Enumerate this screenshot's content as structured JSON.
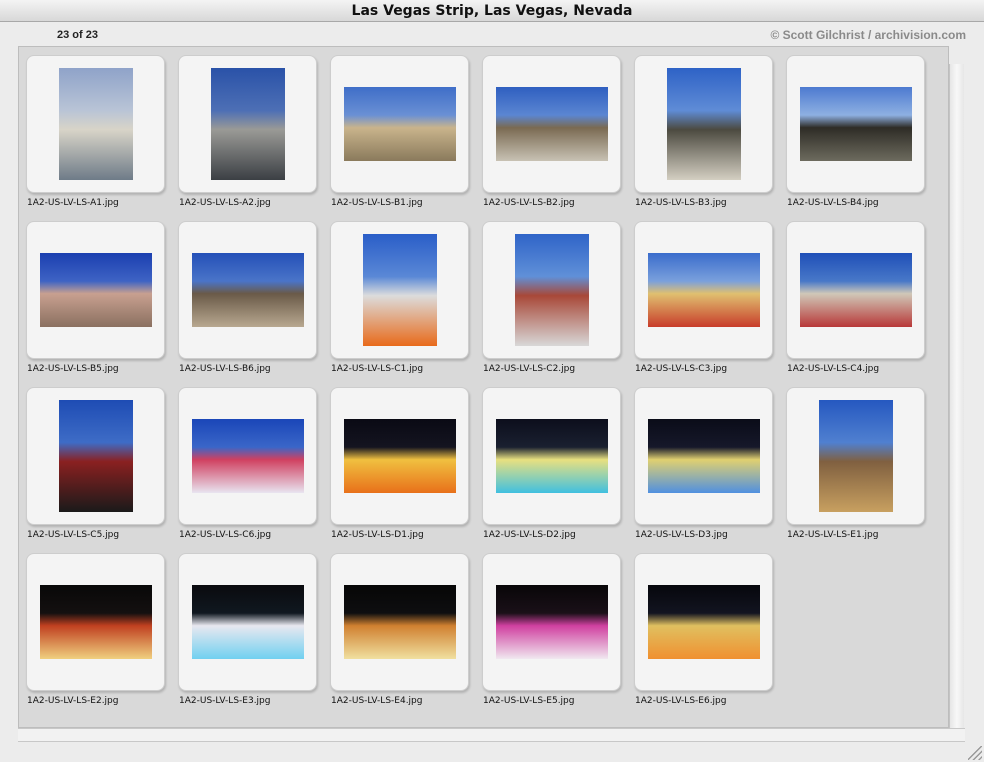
{
  "window": {
    "title": "Las Vegas Strip, Las Vegas, Nevada"
  },
  "header": {
    "count": "23 of 23",
    "copyright": "© Scott Gilchrist / archivision.com"
  },
  "thumbnails": [
    {
      "filename": "1A2-US-LV-LS-A1.jpg",
      "orientation": "portrait",
      "palette": [
        "#8fa3c9",
        "#b9c4d6",
        "#6e7b88",
        "#d8d4c8"
      ]
    },
    {
      "filename": "1A2-US-LV-LS-A2.jpg",
      "orientation": "portrait",
      "palette": [
        "#2a52a8",
        "#4d6fb5",
        "#3b3f44",
        "#9a9a96"
      ]
    },
    {
      "filename": "1A2-US-LV-LS-B1.jpg",
      "orientation": "landscape",
      "palette": [
        "#3f6ec8",
        "#6a90d4",
        "#8a7a5c",
        "#c9b48c"
      ]
    },
    {
      "filename": "1A2-US-LV-LS-B2.jpg",
      "orientation": "landscape",
      "palette": [
        "#2f5fc0",
        "#5b86d2",
        "#c8c2b4",
        "#7a6a52"
      ]
    },
    {
      "filename": "1A2-US-LV-LS-B3.jpg",
      "orientation": "portrait",
      "palette": [
        "#2e62c6",
        "#5f8cd6",
        "#d4cfc2",
        "#4c4a40"
      ]
    },
    {
      "filename": "1A2-US-LV-LS-B4.jpg",
      "orientation": "landscape",
      "palette": [
        "#4d7ad0",
        "#8eb0e2",
        "#6d6b5e",
        "#2e2c26"
      ]
    },
    {
      "filename": "1A2-US-LV-LS-B5.jpg",
      "orientation": "landscape",
      "palette": [
        "#1b3fb0",
        "#3e63c4",
        "#8a7060",
        "#c8a090"
      ]
    },
    {
      "filename": "1A2-US-LV-LS-B6.jpg",
      "orientation": "landscape",
      "palette": [
        "#2450b8",
        "#4a74c8",
        "#b8a890",
        "#6a5a48"
      ]
    },
    {
      "filename": "1A2-US-LV-LS-C1.jpg",
      "orientation": "portrait",
      "palette": [
        "#2a5ec8",
        "#5a88d6",
        "#e86a1a",
        "#dcdcdc"
      ]
    },
    {
      "filename": "1A2-US-LV-LS-C2.jpg",
      "orientation": "portrait",
      "palette": [
        "#2f64c8",
        "#6090d8",
        "#d8d8d8",
        "#a84838"
      ]
    },
    {
      "filename": "1A2-US-LV-LS-C3.jpg",
      "orientation": "landscape",
      "palette": [
        "#3a6ccc",
        "#7aa0dc",
        "#c83c2a",
        "#e0c070"
      ]
    },
    {
      "filename": "1A2-US-LV-LS-C4.jpg",
      "orientation": "landscape",
      "palette": [
        "#1f4fb8",
        "#4878c8",
        "#b83838",
        "#d0c8b8"
      ]
    },
    {
      "filename": "1A2-US-LV-LS-C5.jpg",
      "orientation": "portrait",
      "palette": [
        "#1e4cb4",
        "#3e6cc6",
        "#1a1a1a",
        "#8a2020"
      ]
    },
    {
      "filename": "1A2-US-LV-LS-C6.jpg",
      "orientation": "landscape",
      "palette": [
        "#1a46b8",
        "#3a66c8",
        "#e8e4f0",
        "#d04060"
      ]
    },
    {
      "filename": "1A2-US-LV-LS-D1.jpg",
      "orientation": "landscape",
      "palette": [
        "#0a0a14",
        "#141420",
        "#e8701a",
        "#f0c040"
      ]
    },
    {
      "filename": "1A2-US-LV-LS-D2.jpg",
      "orientation": "landscape",
      "palette": [
        "#0c0e1c",
        "#1a2030",
        "#40c0e0",
        "#e8e080"
      ]
    },
    {
      "filename": "1A2-US-LV-LS-D3.jpg",
      "orientation": "landscape",
      "palette": [
        "#0a0c18",
        "#16182a",
        "#5090e0",
        "#e0d070"
      ]
    },
    {
      "filename": "1A2-US-LV-LS-E1.jpg",
      "orientation": "portrait",
      "palette": [
        "#2558c0",
        "#5080d0",
        "#c8a060",
        "#806040"
      ]
    },
    {
      "filename": "1A2-US-LV-LS-E2.jpg",
      "orientation": "landscape",
      "palette": [
        "#080808",
        "#141010",
        "#f0d080",
        "#c04020"
      ]
    },
    {
      "filename": "1A2-US-LV-LS-E3.jpg",
      "orientation": "landscape",
      "palette": [
        "#0a0a0e",
        "#101820",
        "#70d0f0",
        "#e8e8f0"
      ]
    },
    {
      "filename": "1A2-US-LV-LS-E4.jpg",
      "orientation": "landscape",
      "palette": [
        "#060606",
        "#0e0e10",
        "#f0e0a0",
        "#d08030"
      ]
    },
    {
      "filename": "1A2-US-LV-LS-E5.jpg",
      "orientation": "landscape",
      "palette": [
        "#080608",
        "#1a1018",
        "#f0e8f0",
        "#d040a0"
      ]
    },
    {
      "filename": "1A2-US-LV-LS-E6.jpg",
      "orientation": "landscape",
      "palette": [
        "#06070c",
        "#121420",
        "#f09030",
        "#e0c060"
      ]
    }
  ]
}
